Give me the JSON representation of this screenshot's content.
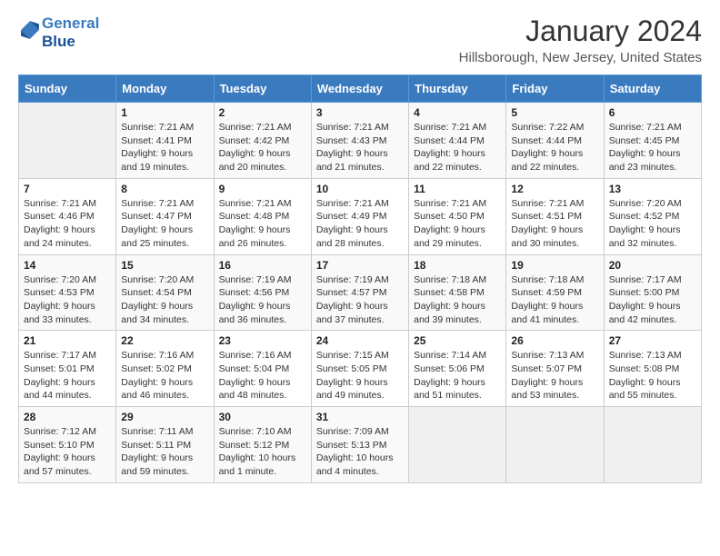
{
  "header": {
    "logo_line1": "General",
    "logo_line2": "Blue",
    "title": "January 2024",
    "subtitle": "Hillsborough, New Jersey, United States"
  },
  "days_of_week": [
    "Sunday",
    "Monday",
    "Tuesday",
    "Wednesday",
    "Thursday",
    "Friday",
    "Saturday"
  ],
  "weeks": [
    [
      {
        "day": "",
        "info": ""
      },
      {
        "day": "1",
        "info": "Sunrise: 7:21 AM\nSunset: 4:41 PM\nDaylight: 9 hours\nand 19 minutes."
      },
      {
        "day": "2",
        "info": "Sunrise: 7:21 AM\nSunset: 4:42 PM\nDaylight: 9 hours\nand 20 minutes."
      },
      {
        "day": "3",
        "info": "Sunrise: 7:21 AM\nSunset: 4:43 PM\nDaylight: 9 hours\nand 21 minutes."
      },
      {
        "day": "4",
        "info": "Sunrise: 7:21 AM\nSunset: 4:44 PM\nDaylight: 9 hours\nand 22 minutes."
      },
      {
        "day": "5",
        "info": "Sunrise: 7:22 AM\nSunset: 4:44 PM\nDaylight: 9 hours\nand 22 minutes."
      },
      {
        "day": "6",
        "info": "Sunrise: 7:21 AM\nSunset: 4:45 PM\nDaylight: 9 hours\nand 23 minutes."
      }
    ],
    [
      {
        "day": "7",
        "info": "Sunrise: 7:21 AM\nSunset: 4:46 PM\nDaylight: 9 hours\nand 24 minutes."
      },
      {
        "day": "8",
        "info": "Sunrise: 7:21 AM\nSunset: 4:47 PM\nDaylight: 9 hours\nand 25 minutes."
      },
      {
        "day": "9",
        "info": "Sunrise: 7:21 AM\nSunset: 4:48 PM\nDaylight: 9 hours\nand 26 minutes."
      },
      {
        "day": "10",
        "info": "Sunrise: 7:21 AM\nSunset: 4:49 PM\nDaylight: 9 hours\nand 28 minutes."
      },
      {
        "day": "11",
        "info": "Sunrise: 7:21 AM\nSunset: 4:50 PM\nDaylight: 9 hours\nand 29 minutes."
      },
      {
        "day": "12",
        "info": "Sunrise: 7:21 AM\nSunset: 4:51 PM\nDaylight: 9 hours\nand 30 minutes."
      },
      {
        "day": "13",
        "info": "Sunrise: 7:20 AM\nSunset: 4:52 PM\nDaylight: 9 hours\nand 32 minutes."
      }
    ],
    [
      {
        "day": "14",
        "info": "Sunrise: 7:20 AM\nSunset: 4:53 PM\nDaylight: 9 hours\nand 33 minutes."
      },
      {
        "day": "15",
        "info": "Sunrise: 7:20 AM\nSunset: 4:54 PM\nDaylight: 9 hours\nand 34 minutes."
      },
      {
        "day": "16",
        "info": "Sunrise: 7:19 AM\nSunset: 4:56 PM\nDaylight: 9 hours\nand 36 minutes."
      },
      {
        "day": "17",
        "info": "Sunrise: 7:19 AM\nSunset: 4:57 PM\nDaylight: 9 hours\nand 37 minutes."
      },
      {
        "day": "18",
        "info": "Sunrise: 7:18 AM\nSunset: 4:58 PM\nDaylight: 9 hours\nand 39 minutes."
      },
      {
        "day": "19",
        "info": "Sunrise: 7:18 AM\nSunset: 4:59 PM\nDaylight: 9 hours\nand 41 minutes."
      },
      {
        "day": "20",
        "info": "Sunrise: 7:17 AM\nSunset: 5:00 PM\nDaylight: 9 hours\nand 42 minutes."
      }
    ],
    [
      {
        "day": "21",
        "info": "Sunrise: 7:17 AM\nSunset: 5:01 PM\nDaylight: 9 hours\nand 44 minutes."
      },
      {
        "day": "22",
        "info": "Sunrise: 7:16 AM\nSunset: 5:02 PM\nDaylight: 9 hours\nand 46 minutes."
      },
      {
        "day": "23",
        "info": "Sunrise: 7:16 AM\nSunset: 5:04 PM\nDaylight: 9 hours\nand 48 minutes."
      },
      {
        "day": "24",
        "info": "Sunrise: 7:15 AM\nSunset: 5:05 PM\nDaylight: 9 hours\nand 49 minutes."
      },
      {
        "day": "25",
        "info": "Sunrise: 7:14 AM\nSunset: 5:06 PM\nDaylight: 9 hours\nand 51 minutes."
      },
      {
        "day": "26",
        "info": "Sunrise: 7:13 AM\nSunset: 5:07 PM\nDaylight: 9 hours\nand 53 minutes."
      },
      {
        "day": "27",
        "info": "Sunrise: 7:13 AM\nSunset: 5:08 PM\nDaylight: 9 hours\nand 55 minutes."
      }
    ],
    [
      {
        "day": "28",
        "info": "Sunrise: 7:12 AM\nSunset: 5:10 PM\nDaylight: 9 hours\nand 57 minutes."
      },
      {
        "day": "29",
        "info": "Sunrise: 7:11 AM\nSunset: 5:11 PM\nDaylight: 9 hours\nand 59 minutes."
      },
      {
        "day": "30",
        "info": "Sunrise: 7:10 AM\nSunset: 5:12 PM\nDaylight: 10 hours\nand 1 minute."
      },
      {
        "day": "31",
        "info": "Sunrise: 7:09 AM\nSunset: 5:13 PM\nDaylight: 10 hours\nand 4 minutes."
      },
      {
        "day": "",
        "info": ""
      },
      {
        "day": "",
        "info": ""
      },
      {
        "day": "",
        "info": ""
      }
    ]
  ]
}
